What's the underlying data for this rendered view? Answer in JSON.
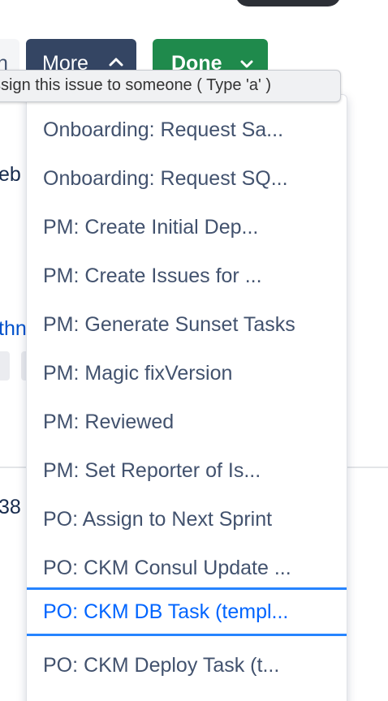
{
  "toolbar": {
    "prev_button_label": "n",
    "more_button_label": "More",
    "done_button_label": "Done"
  },
  "tooltip": {
    "text": "ssign this issue to someone ( Type 'a' )"
  },
  "background": {
    "fragment_1": "eb",
    "fragment_2": "thn",
    "fragment_3": "38"
  },
  "menu": {
    "items": [
      {
        "label": "Onboarding: Request Sa..."
      },
      {
        "label": "Onboarding: Request SQ..."
      },
      {
        "label": "PM: Create Initial Dep..."
      },
      {
        "label": "PM: Create Issues for ..."
      },
      {
        "label": "PM: Generate Sunset Tasks"
      },
      {
        "label": "PM: Magic fixVersion"
      },
      {
        "label": "PM: Reviewed"
      },
      {
        "label": "PM: Set Reporter of Is..."
      },
      {
        "label": "PO: Assign to Next Sprint"
      },
      {
        "label": "PO: CKM Consul Update ..."
      },
      {
        "label": "PO: CKM DB Task (templ..."
      },
      {
        "label": "PO: CKM Deploy Task (t..."
      }
    ],
    "active_index": 10
  },
  "colors": {
    "more_button": "#344563",
    "done_button": "#1f8a4c",
    "menu_text": "#42526e",
    "active_text": "#0065ff",
    "active_border": "#2684ff"
  }
}
